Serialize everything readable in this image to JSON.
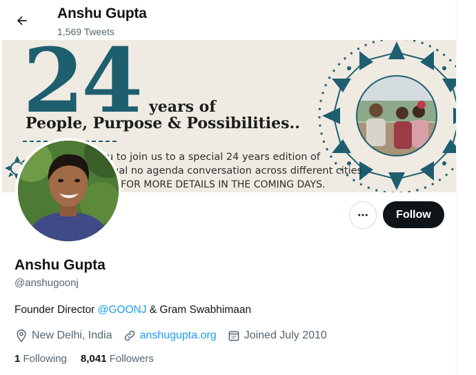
{
  "header": {
    "name": "Anshu Gupta",
    "tweet_count": "1,569 Tweets"
  },
  "banner": {
    "big_number": "24",
    "years_text": "years of",
    "tagline": "People, Purpose & Possibilities..",
    "line1": "u to join us to a special 24 years edition of",
    "line2": "ual no agenda conversation  across different cities",
    "line3": "FOR MORE DETAILS IN THE COMING DAYS."
  },
  "actions": {
    "follow_label": "Follow"
  },
  "profile": {
    "name": "Anshu Gupta",
    "handle": "@anshugoonj",
    "bio_prefix": "Founder Director ",
    "bio_mention": "@GOONJ",
    "bio_suffix": " & Gram Swabhimaan",
    "location": "New Delhi, India",
    "website": "anshugupta.org",
    "joined": "Joined July 2010"
  },
  "stats": {
    "following_count": "1",
    "following_label": "Following",
    "followers_count": "8,041",
    "followers_label": "Followers"
  },
  "colors": {
    "accent": "#1d9bf0",
    "text": "#0f1419",
    "muted": "#536471",
    "banner_teal": "#1e5f6f"
  },
  "icons": [
    "back-arrow-icon",
    "more-icon",
    "location-icon",
    "link-icon",
    "calendar-icon"
  ]
}
